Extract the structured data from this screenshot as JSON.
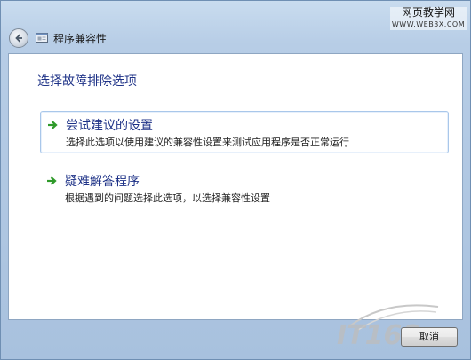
{
  "window": {
    "title": "程序兼容性"
  },
  "watermark_top": {
    "main": "网页教学网",
    "url": "WWW.WEB3X.COM"
  },
  "watermark_bottom": {
    "text": "IT168.com"
  },
  "content": {
    "heading": "选择故障排除选项",
    "options": [
      {
        "title": "尝试建议的设置",
        "description": "选择此选项以使用建议的兼容性设置来测试应用程序是否正常运行"
      },
      {
        "title": "疑难解答程序",
        "description": "根据遇到的问题选择此选项，以选择兼容性设置"
      }
    ]
  },
  "footer": {
    "cancel_label": "取消"
  },
  "colors": {
    "link_blue": "#1e3287",
    "arrow_green": "#2f9a2a",
    "window_frame": "#b7cde6"
  }
}
